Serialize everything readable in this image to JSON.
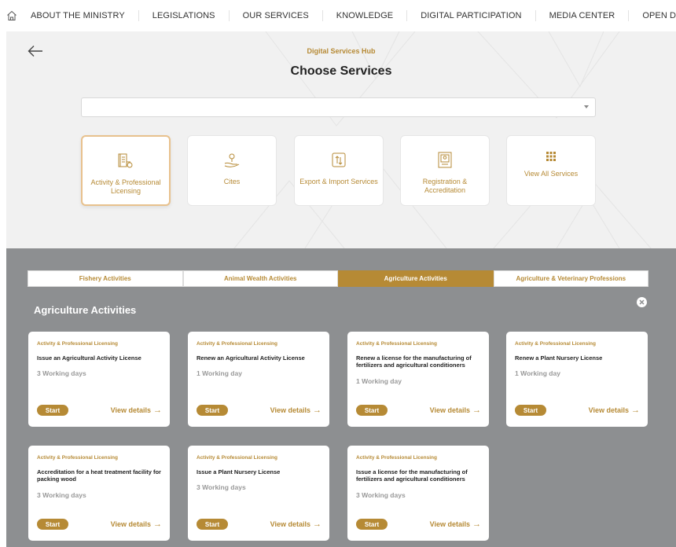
{
  "nav": {
    "items": [
      "ABOUT THE MINISTRY",
      "LEGISLATIONS",
      "OUR SERVICES",
      "KNOWLEDGE",
      "DIGITAL PARTICIPATION",
      "MEDIA CENTER",
      "OPEN DATA"
    ]
  },
  "hero": {
    "subtitle": "Digital Services Hub",
    "title": "Choose Services",
    "select_value": ""
  },
  "service_cards": [
    {
      "label": "Activity & Professional Licensing",
      "icon": "licensing-icon"
    },
    {
      "label": "Cites",
      "icon": "hand-plant-icon"
    },
    {
      "label": "Export & Import Services",
      "icon": "export-import-icon"
    },
    {
      "label": "Registration & Accreditation",
      "icon": "registration-icon"
    },
    {
      "label": "View All Services",
      "icon": "grid-icon"
    }
  ],
  "tabs": [
    "Fishery Activities",
    "Animal Wealth Activities",
    "Agriculture Activities",
    "Agriculture & Veterinary Professions"
  ],
  "section_title": "Agriculture Activities",
  "cards": [
    {
      "category": "Activity & Professional Licensing",
      "title": "Issue an Agricultural Activity License",
      "duration": "3 Working days",
      "start": "Start",
      "details": "View details"
    },
    {
      "category": "Activity & Professional Licensing",
      "title": "Renew an Agricultural Activity License",
      "duration": "1 Working day",
      "start": "Start",
      "details": "View details"
    },
    {
      "category": "Activity & Professional Licensing",
      "title": "Renew a license for the manufacturing of fertilizers and agricultural conditioners",
      "duration": "1 Working day",
      "start": "Start",
      "details": "View details"
    },
    {
      "category": "Activity & Professional Licensing",
      "title": "Renew a Plant Nursery License",
      "duration": "1 Working day",
      "start": "Start",
      "details": "View details"
    },
    {
      "category": "Activity & Professional Licensing",
      "title": "Accreditation for a heat treatment facility for packing wood",
      "duration": "3 Working days",
      "start": "Start",
      "details": "View details"
    },
    {
      "category": "Activity & Professional Licensing",
      "title": "Issue a Plant Nursery License",
      "duration": "3 Working days",
      "start": "Start",
      "details": "View details"
    },
    {
      "category": "Activity & Professional Licensing",
      "title": "Issue a license for the manufacturing of fertilizers and agricultural conditioners",
      "duration": "3 Working days",
      "start": "Start",
      "details": "View details"
    }
  ],
  "colors": {
    "accent": "#b68a35",
    "section_bg": "#8d8f91",
    "hero_bg": "#f1f1f1"
  }
}
